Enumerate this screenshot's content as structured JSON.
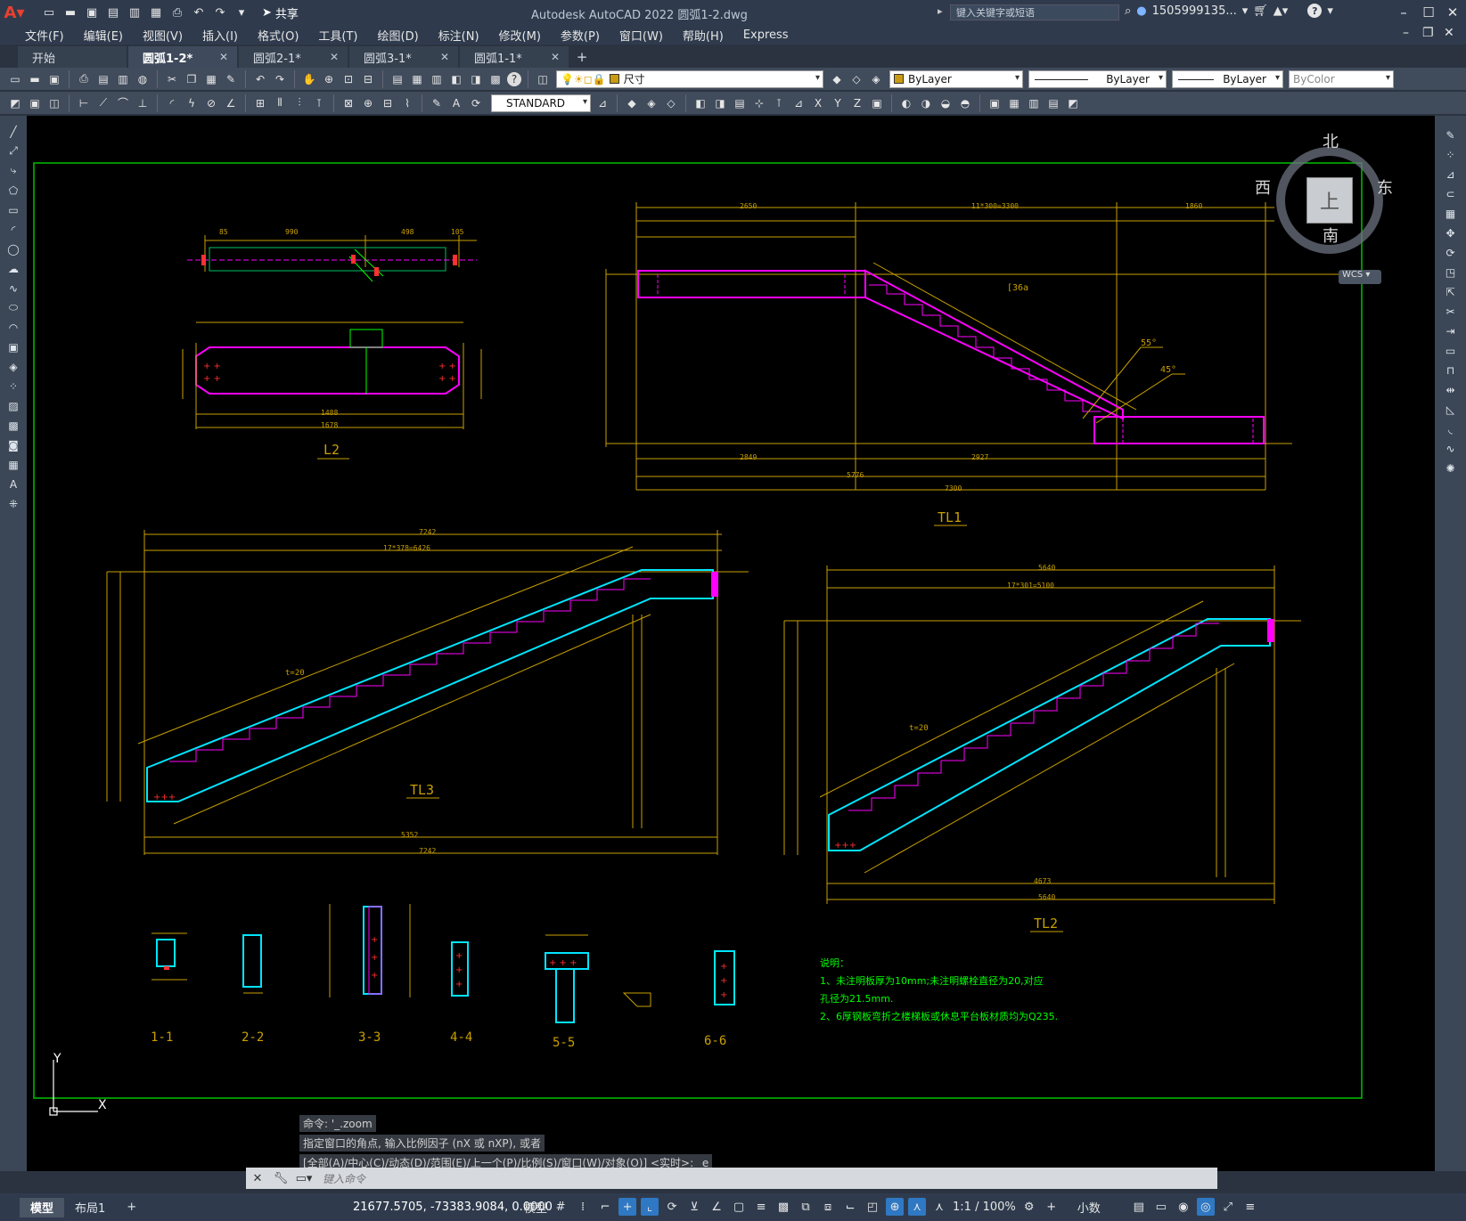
{
  "titlebar": {
    "app_letter": "A",
    "share_label": "共享",
    "title": "Autodesk AutoCAD 2022    圆弧1-2.dwg",
    "search_placeholder": "键入关键字或短语",
    "user": "1505999135...",
    "help": "?"
  },
  "menu": [
    "文件(F)",
    "编辑(E)",
    "视图(V)",
    "插入(I)",
    "格式(O)",
    "工具(T)",
    "绘图(D)",
    "标注(N)",
    "修改(M)",
    "参数(P)",
    "窗口(W)",
    "帮助(H)",
    "Express"
  ],
  "tabs": [
    {
      "label": "开始",
      "closable": false
    },
    {
      "label": "圆弧1-2*",
      "closable": true,
      "active": true
    },
    {
      "label": "圆弧2-1*",
      "closable": true
    },
    {
      "label": "圆弧3-1*",
      "closable": true
    },
    {
      "label": "圆弧1-1*",
      "closable": true
    }
  ],
  "layer_combo": "尺寸",
  "props": {
    "color": "ByLayer",
    "linetype": "ByLayer",
    "lineweight": "ByLayer",
    "plotstyle": "ByColor"
  },
  "dimstyle": "STANDARD",
  "viewcube": {
    "north": "北",
    "south": "南",
    "east": "东",
    "west": "西",
    "face": "上",
    "wcs": "WCS"
  },
  "drawing": {
    "labels": {
      "L2": "L2",
      "TL1": "TL1",
      "TL3": "TL3",
      "TL2": "TL2"
    },
    "sections": [
      "1-1",
      "2-2",
      "3-3",
      "4-4",
      "5-5",
      "6-6"
    ],
    "notes": [
      "说明：",
      "1、未注明板厚为10mm;未注明螺栓直径为20,对应",
      "   孔径为21.5mm.",
      "2、6厚钢板弯折之楼梯板或休息平台板材质均为Q235."
    ],
    "dims_L2_top": [
      "85",
      "990",
      "498",
      "105"
    ],
    "dims_L2_bottom": [
      "1488",
      "1678"
    ],
    "dims_TL1_top": [
      "2650",
      "11*300=3300",
      "1860"
    ],
    "dims_TL1_bottom": [
      "2849",
      "2927",
      "5776",
      "7300"
    ],
    "dims_TL3": [
      "7242",
      "17*378=6426",
      "5352",
      "7242",
      "t=20"
    ],
    "dims_TL2": [
      "5640",
      "17*301=5100",
      "4673",
      "5640",
      "t=20"
    ],
    "angles": [
      "55°",
      "45°"
    ],
    "beam_tag": "[36a"
  },
  "command": {
    "history": [
      "命令: '_.zoom",
      "指定窗口的角点, 输入比例因子 (nX 或 nXP), 或者",
      "[全部(A)/中心(C)/动态(D)/范围(E)/上一个(P)/比例(S)/窗口(W)/对象(O)] <实时>: _e"
    ],
    "placeholder": "键入命令"
  },
  "status": {
    "layout_tabs": [
      "模型",
      "布局1"
    ],
    "coords": "21677.5705, -73383.9084, 0.0000",
    "space": "模型",
    "scale": "1:1 / 100%",
    "units": "小数"
  },
  "colors": {
    "cad_magenta": "#ff00ff",
    "cad_cyan": "#00e5ff",
    "cad_dim": "#c8a000",
    "cad_green": "#00ff00",
    "cad_red": "#ff3030",
    "border_green": "#00c000"
  }
}
